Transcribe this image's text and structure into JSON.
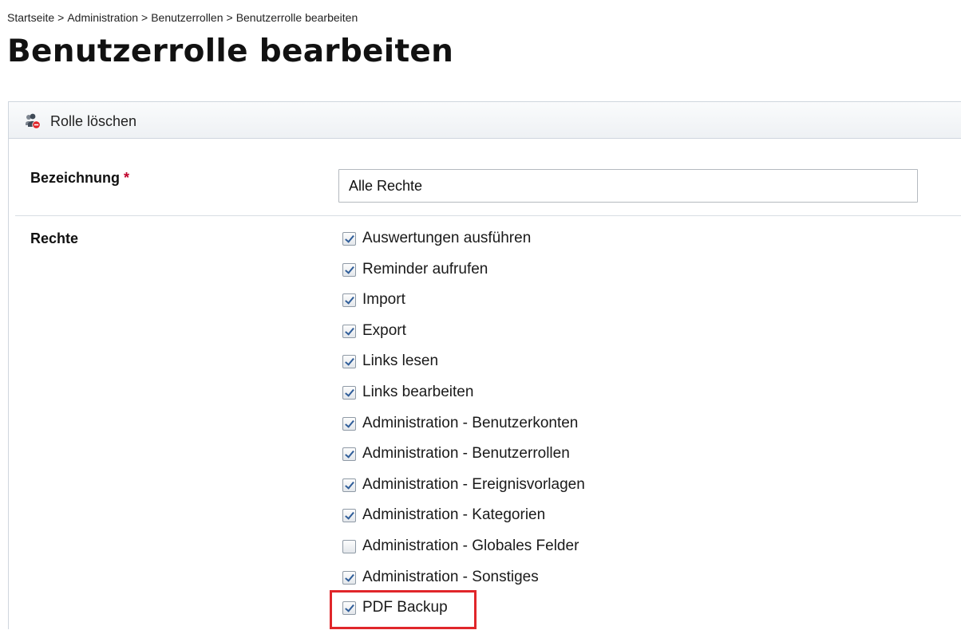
{
  "breadcrumb": {
    "items": [
      "Startseite",
      "Administration",
      "Benutzerrollen",
      "Benutzerrolle bearbeiten"
    ],
    "separator": ">"
  },
  "page": {
    "title": "Benutzerrolle bearbeiten"
  },
  "toolbar": {
    "delete_role_label": "Rolle löschen",
    "delete_role_icon": "delete-role-icon"
  },
  "form": {
    "name_label": "Bezeichnung",
    "name_required_marker": "*",
    "name_value": "Alle Rechte",
    "rights_label": "Rechte",
    "rights": [
      {
        "label": "Auswertungen ausführen",
        "checked": true
      },
      {
        "label": "Reminder aufrufen",
        "checked": true
      },
      {
        "label": "Import",
        "checked": true
      },
      {
        "label": "Export",
        "checked": true
      },
      {
        "label": "Links lesen",
        "checked": true
      },
      {
        "label": "Links bearbeiten",
        "checked": true
      },
      {
        "label": "Administration - Benutzerkonten",
        "checked": true
      },
      {
        "label": "Administration - Benutzerrollen",
        "checked": true
      },
      {
        "label": "Administration - Ereignisvorlagen",
        "checked": true
      },
      {
        "label": "Administration - Kategorien",
        "checked": true
      },
      {
        "label": "Administration - Globales Felder",
        "checked": false
      },
      {
        "label": "Administration - Sonstiges",
        "checked": true
      },
      {
        "label": "PDF Backup",
        "checked": true
      }
    ]
  },
  "colors": {
    "required": "#c0002a",
    "highlight": "#e0262a",
    "check": "#2f5d99"
  }
}
